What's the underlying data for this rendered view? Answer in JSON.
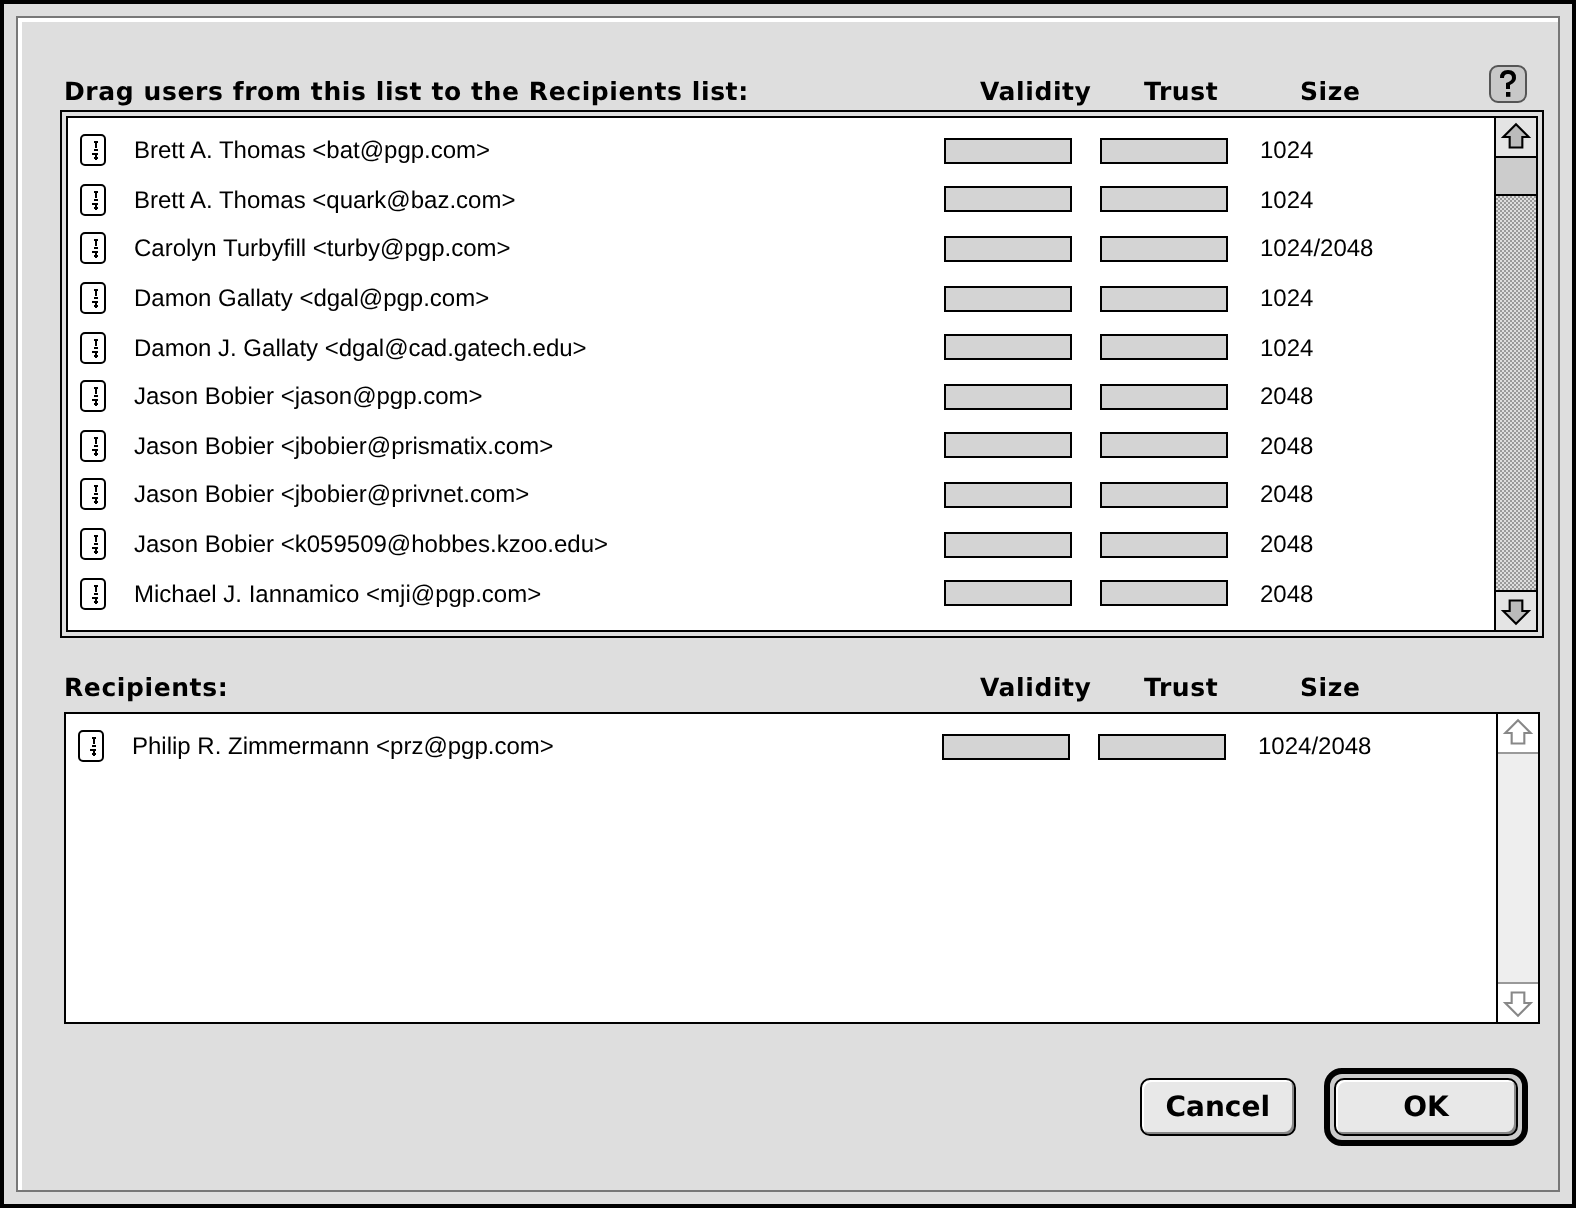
{
  "keyring": {
    "heading": "Drag users from this list to the Recipients list:",
    "columns": [
      "Validity",
      "Trust",
      "Size"
    ],
    "scrollable": true,
    "rows": [
      {
        "user": "Brett A. Thomas <bat@pgp.com>",
        "validity": {
          "level": 0
        },
        "trust": {
          "level": 0
        },
        "size": "1024"
      },
      {
        "user": "Brett A. Thomas <quark@baz.com>",
        "validity": {
          "level": 0
        },
        "trust": {
          "level": 0
        },
        "size": "1024"
      },
      {
        "user": "Carolyn Turbyfill <turby@pgp.com>",
        "validity": {
          "level": 0
        },
        "trust": {
          "level": 0
        },
        "size": "1024/2048"
      },
      {
        "user": "Damon Gallaty <dgal@pgp.com>",
        "validity": {
          "level": 0
        },
        "trust": {
          "level": 0
        },
        "size": "1024"
      },
      {
        "user": "Damon J. Gallaty <dgal@cad.gatech.edu>",
        "validity": {
          "level": 0
        },
        "trust": {
          "level": 0
        },
        "size": "1024"
      },
      {
        "user": "Jason Bobier <jason@pgp.com>",
        "validity": {
          "level": 0
        },
        "trust": {
          "level": 0
        },
        "size": "2048"
      },
      {
        "user": "Jason Bobier <jbobier@prismatix.com>",
        "validity": {
          "level": 0
        },
        "trust": {
          "level": 0
        },
        "size": "2048"
      },
      {
        "user": "Jason Bobier <jbobier@privnet.com>",
        "validity": {
          "level": 0
        },
        "trust": {
          "level": 0
        },
        "size": "2048"
      },
      {
        "user": "Jason Bobier <k059509@hobbes.kzoo.edu>",
        "validity": {
          "level": 0
        },
        "trust": {
          "level": 0
        },
        "size": "2048"
      },
      {
        "user": "Michael J. Iannamico <mji@pgp.com>",
        "validity": {
          "level": 0
        },
        "trust": {
          "level": 0
        },
        "size": "2048"
      }
    ]
  },
  "recipients": {
    "heading": "Recipients:",
    "columns": [
      "Validity",
      "Trust",
      "Size"
    ],
    "scrollable": false,
    "rows": [
      {
        "user": "Philip R. Zimmermann <prz@pgp.com>",
        "validity": {
          "level": 0
        },
        "trust": {
          "level": 0
        },
        "size": "1024/2048"
      }
    ]
  },
  "buttons": [
    {
      "label": "Cancel",
      "default": false
    },
    {
      "label": "OK",
      "default": true
    }
  ]
}
